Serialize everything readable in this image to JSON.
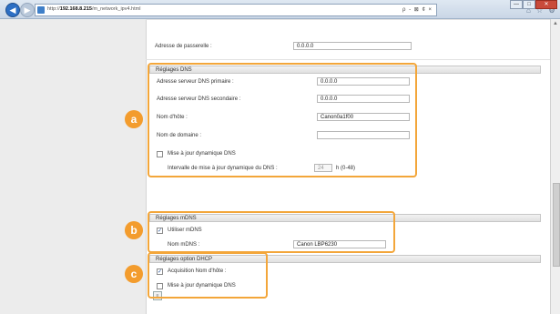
{
  "browser": {
    "url_prefix": "http://",
    "url_host": "192.168.8.215",
    "url_path": "/m_network_ipv4.html",
    "address_tools": "ρ - ⊠ ¢ ×",
    "tab_icons": "⌂ ☆ ⚙",
    "window_buttons": {
      "minimize": "—",
      "maximize": "□",
      "close": "✕"
    }
  },
  "gateway": {
    "label": "Adresse de passerelle :",
    "value": "0.0.0.0"
  },
  "dns": {
    "header": "Réglages DNS",
    "primary_label": "Adresse serveur DNS primaire :",
    "primary_value": "0.0.0.0",
    "secondary_label": "Adresse serveur DNS secondaire :",
    "secondary_value": "0.0.0.0",
    "hostname_label": "Nom d'hôte :",
    "hostname_value": "Canon0a1f00",
    "domain_label": "Nom de domaine :",
    "domain_value": "",
    "dynamic_update_label": "Mise à jour dynamique DNS",
    "dynamic_update_checked": false,
    "interval_label": "Intervalle de mise à jour dynamique du DNS :",
    "interval_value": "24",
    "interval_unit": "h (0-48)"
  },
  "mdns": {
    "header": "Réglages mDNS",
    "use_label": "Utiliser mDNS",
    "use_checked": true,
    "name_label": "Nom mDNS :",
    "name_value": "Canon LBP6230"
  },
  "dhcp": {
    "header": "Réglages option DHCP",
    "hostname_label": "Acquisition Nom d'hôte :",
    "hostname_checked": true,
    "dns_update_label": "Mise à jour dynamique DNS",
    "dns_update_checked": false
  },
  "badges": {
    "a": "a",
    "b": "b",
    "c": "c"
  },
  "colors": {
    "accent_orange": "#f39c2d",
    "browser_blue": "#2d6fc4"
  }
}
